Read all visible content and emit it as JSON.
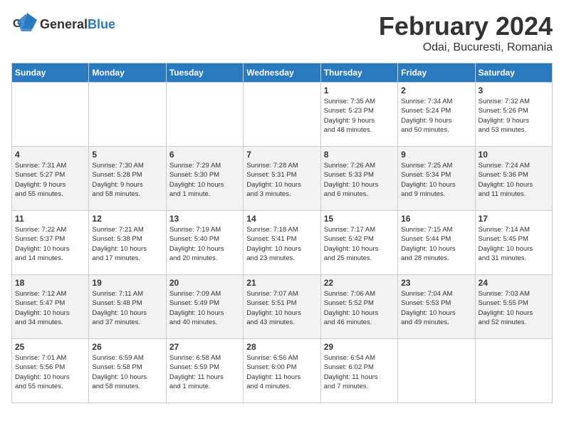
{
  "header": {
    "logo_general": "General",
    "logo_blue": "Blue",
    "month_title": "February 2024",
    "location": "Odai, Bucuresti, Romania"
  },
  "days_of_week": [
    "Sunday",
    "Monday",
    "Tuesday",
    "Wednesday",
    "Thursday",
    "Friday",
    "Saturday"
  ],
  "weeks": [
    [
      {
        "day": "",
        "info": ""
      },
      {
        "day": "",
        "info": ""
      },
      {
        "day": "",
        "info": ""
      },
      {
        "day": "",
        "info": ""
      },
      {
        "day": "1",
        "info": "Sunrise: 7:35 AM\nSunset: 5:23 PM\nDaylight: 9 hours\nand 48 minutes."
      },
      {
        "day": "2",
        "info": "Sunrise: 7:34 AM\nSunset: 5:24 PM\nDaylight: 9 hours\nand 50 minutes."
      },
      {
        "day": "3",
        "info": "Sunrise: 7:32 AM\nSunset: 5:26 PM\nDaylight: 9 hours\nand 53 minutes."
      }
    ],
    [
      {
        "day": "4",
        "info": "Sunrise: 7:31 AM\nSunset: 5:27 PM\nDaylight: 9 hours\nand 55 minutes."
      },
      {
        "day": "5",
        "info": "Sunrise: 7:30 AM\nSunset: 5:28 PM\nDaylight: 9 hours\nand 58 minutes."
      },
      {
        "day": "6",
        "info": "Sunrise: 7:29 AM\nSunset: 5:30 PM\nDaylight: 10 hours\nand 1 minute."
      },
      {
        "day": "7",
        "info": "Sunrise: 7:28 AM\nSunset: 5:31 PM\nDaylight: 10 hours\nand 3 minutes."
      },
      {
        "day": "8",
        "info": "Sunrise: 7:26 AM\nSunset: 5:33 PM\nDaylight: 10 hours\nand 6 minutes."
      },
      {
        "day": "9",
        "info": "Sunrise: 7:25 AM\nSunset: 5:34 PM\nDaylight: 10 hours\nand 9 minutes."
      },
      {
        "day": "10",
        "info": "Sunrise: 7:24 AM\nSunset: 5:36 PM\nDaylight: 10 hours\nand 11 minutes."
      }
    ],
    [
      {
        "day": "11",
        "info": "Sunrise: 7:22 AM\nSunset: 5:37 PM\nDaylight: 10 hours\nand 14 minutes."
      },
      {
        "day": "12",
        "info": "Sunrise: 7:21 AM\nSunset: 5:38 PM\nDaylight: 10 hours\nand 17 minutes."
      },
      {
        "day": "13",
        "info": "Sunrise: 7:19 AM\nSunset: 5:40 PM\nDaylight: 10 hours\nand 20 minutes."
      },
      {
        "day": "14",
        "info": "Sunrise: 7:18 AM\nSunset: 5:41 PM\nDaylight: 10 hours\nand 23 minutes."
      },
      {
        "day": "15",
        "info": "Sunrise: 7:17 AM\nSunset: 5:42 PM\nDaylight: 10 hours\nand 25 minutes."
      },
      {
        "day": "16",
        "info": "Sunrise: 7:15 AM\nSunset: 5:44 PM\nDaylight: 10 hours\nand 28 minutes."
      },
      {
        "day": "17",
        "info": "Sunrise: 7:14 AM\nSunset: 5:45 PM\nDaylight: 10 hours\nand 31 minutes."
      }
    ],
    [
      {
        "day": "18",
        "info": "Sunrise: 7:12 AM\nSunset: 5:47 PM\nDaylight: 10 hours\nand 34 minutes."
      },
      {
        "day": "19",
        "info": "Sunrise: 7:11 AM\nSunset: 5:48 PM\nDaylight: 10 hours\nand 37 minutes."
      },
      {
        "day": "20",
        "info": "Sunrise: 7:09 AM\nSunset: 5:49 PM\nDaylight: 10 hours\nand 40 minutes."
      },
      {
        "day": "21",
        "info": "Sunrise: 7:07 AM\nSunset: 5:51 PM\nDaylight: 10 hours\nand 43 minutes."
      },
      {
        "day": "22",
        "info": "Sunrise: 7:06 AM\nSunset: 5:52 PM\nDaylight: 10 hours\nand 46 minutes."
      },
      {
        "day": "23",
        "info": "Sunrise: 7:04 AM\nSunset: 5:53 PM\nDaylight: 10 hours\nand 49 minutes."
      },
      {
        "day": "24",
        "info": "Sunrise: 7:03 AM\nSunset: 5:55 PM\nDaylight: 10 hours\nand 52 minutes."
      }
    ],
    [
      {
        "day": "25",
        "info": "Sunrise: 7:01 AM\nSunset: 5:56 PM\nDaylight: 10 hours\nand 55 minutes."
      },
      {
        "day": "26",
        "info": "Sunrise: 6:59 AM\nSunset: 5:58 PM\nDaylight: 10 hours\nand 58 minutes."
      },
      {
        "day": "27",
        "info": "Sunrise: 6:58 AM\nSunset: 5:59 PM\nDaylight: 11 hours\nand 1 minute."
      },
      {
        "day": "28",
        "info": "Sunrise: 6:56 AM\nSunset: 6:00 PM\nDaylight: 11 hours\nand 4 minutes."
      },
      {
        "day": "29",
        "info": "Sunrise: 6:54 AM\nSunset: 6:02 PM\nDaylight: 11 hours\nand 7 minutes."
      },
      {
        "day": "",
        "info": ""
      },
      {
        "day": "",
        "info": ""
      }
    ]
  ]
}
